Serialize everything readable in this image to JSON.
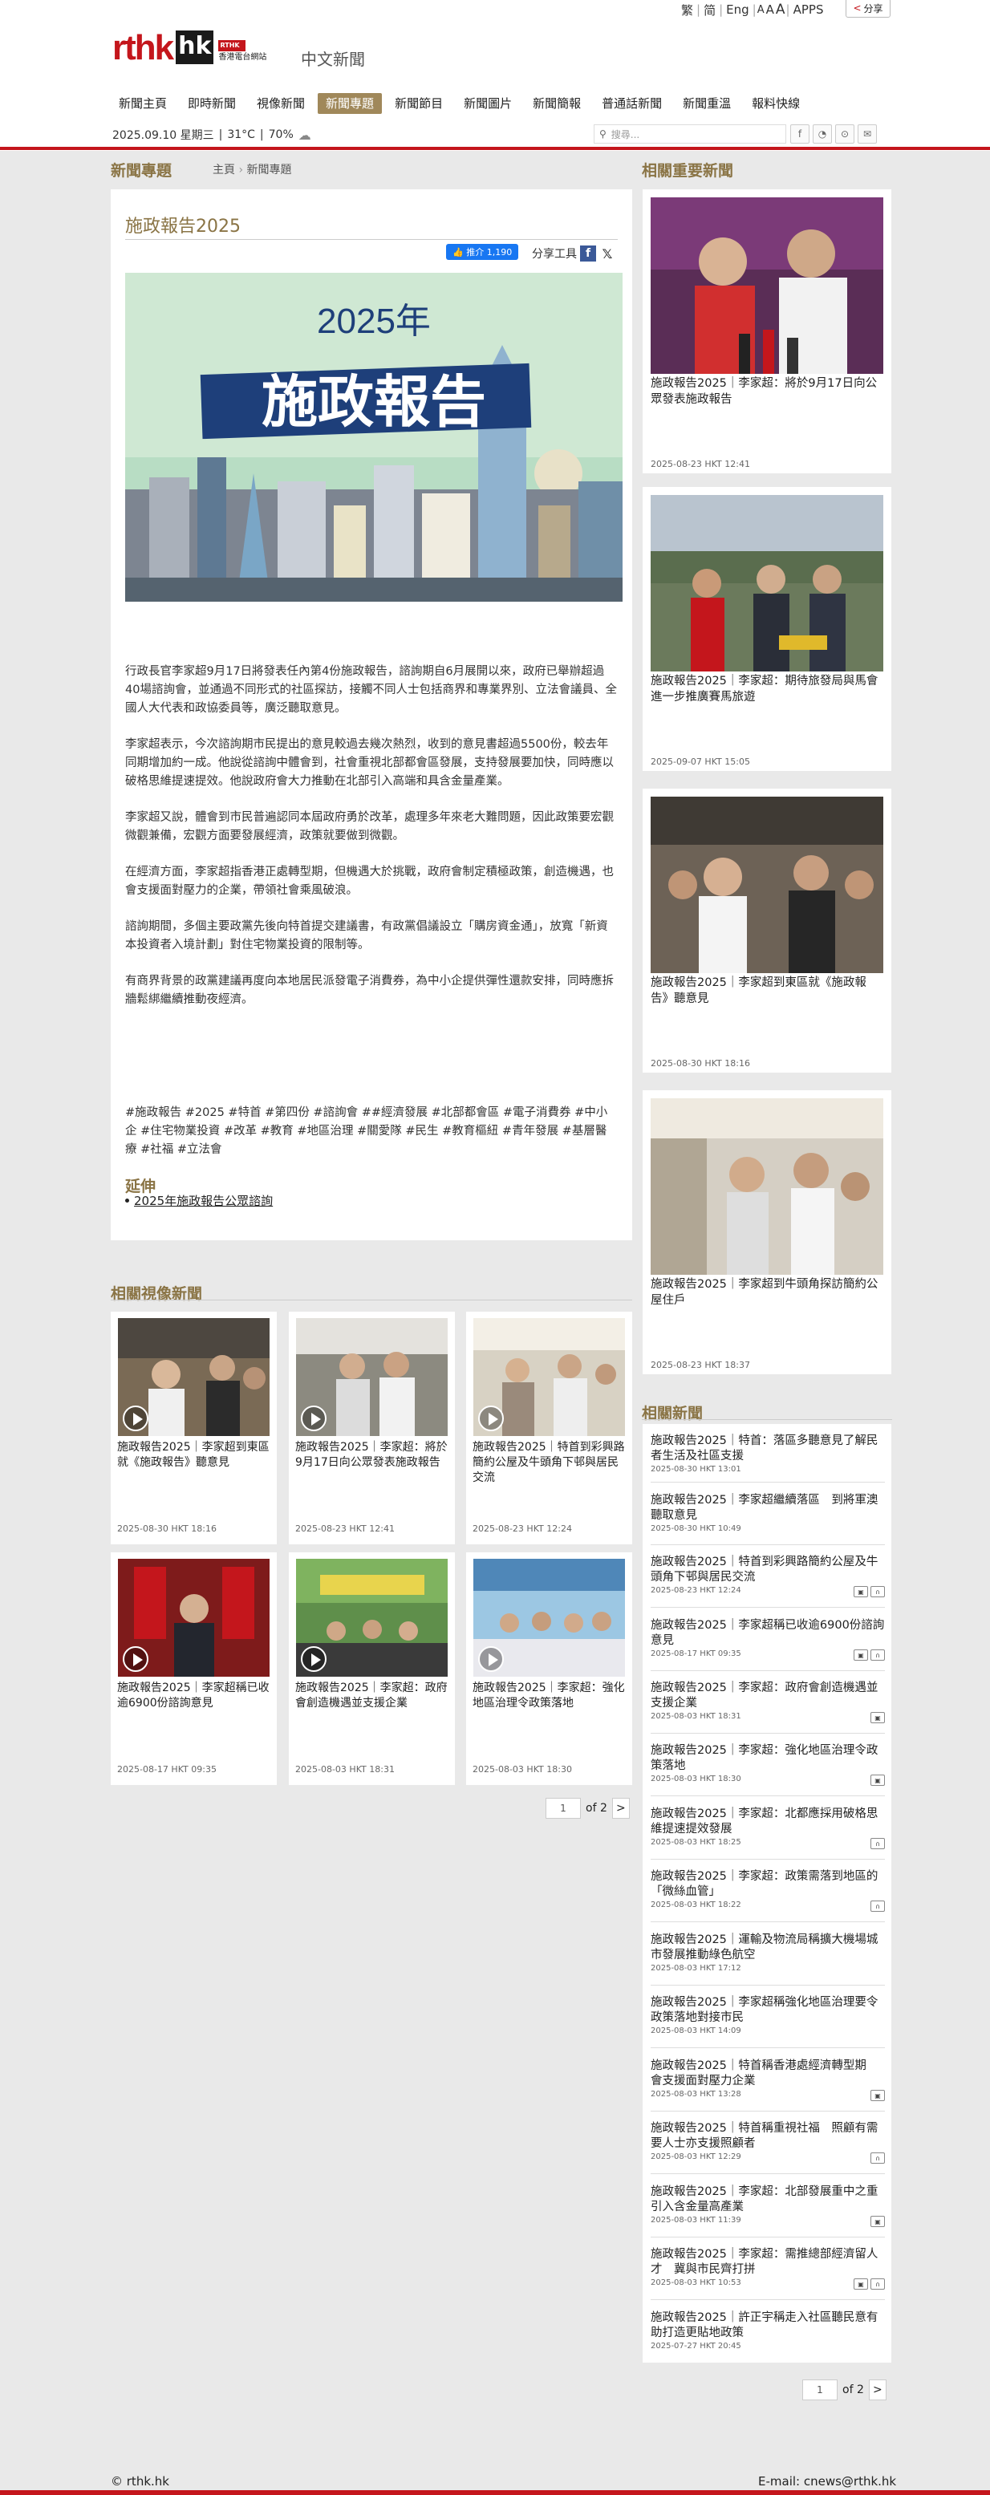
{
  "header": {
    "lang_links": [
      "繁",
      "简",
      "Eng",
      "A",
      "A",
      "A",
      "APPS"
    ],
    "share_label": "分享",
    "logo_text": "rthk",
    "logo_hk": "hk",
    "logo_station": "香港電台網站",
    "site_name": "中文新聞",
    "nav": [
      "新聞主頁",
      "即時新聞",
      "視像新聞",
      "新聞專題",
      "新聞節目",
      "新聞圖片",
      "新聞簡報",
      "普通話新聞",
      "新聞重溫",
      "報料快線"
    ],
    "nav_active_index": 3,
    "date": "2025.09.10 星期三",
    "temperature": "31°C",
    "humidity": "70%",
    "search_placeholder": "搜尋..."
  },
  "page": {
    "section_title": "新聞專題",
    "breadcrumb": [
      "主頁",
      "新聞專題"
    ]
  },
  "article": {
    "title": "施政報告2025",
    "fb_like": "推介 1,190",
    "share_tools": "分享工具",
    "hero_title_year": "2025年",
    "hero_title": "施政報告",
    "paragraphs": [
      "行政長官李家超9月17日將發表任內第4份施政報告，諮詢期自6月展開以來，政府已舉辦超過40場諮詢會，並通過不同形式的社區探訪，接觸不同人士包括商界和專業界別、立法會議員、全國人大代表和政協委員等，廣泛聽取意見。",
      "李家超表示，今次諮詢期市民提出的意見較過去幾次熱烈，收到的意見書超過5500份，較去年同期增加約一成。他說從諮詢中體會到，社會重視北部都會區發展，支持發展要加快，同時應以破格思維提速提效。他說政府會大力推動在北部引入高端和具含金量產業。",
      "李家超又說，體會到市民普遍認同本屆政府勇於改革，處理多年來老大難問題，因此政策要宏觀微觀兼備，宏觀方面要發展經濟，政策就要做到微觀。",
      "在經濟方面，李家超指香港正處轉型期，但機遇大於挑戰，政府會制定積極政策，創造機遇，也會支援面對壓力的企業，帶領社會乘風破浪。",
      "諮詢期間，多個主要政黨先後向特首提交建議書，有政黨倡議設立「購房資金通」，放寬「新資本投資者入境計劃」對住宅物業投資的限制等。",
      "有商界背景的政黨建議再度向本地居民派發電子消費券，為中小企提供彈性還款安排，同時應拆牆鬆綁繼續推動夜經濟。"
    ],
    "tags": "#施政報告 #2025 #特首 #第四份 #諮詢會 ##經濟發展 #北部都會區 #電子消費券 #中小企 #住宅物業投資 #改革 #教育 #地區治理 #關愛隊 #民生 #教育樞紐 #青年發展 #基層醫療 #社福 #立法會",
    "extend_title": "延伸",
    "extend_links": [
      "2025年施政報告公眾諮詢"
    ]
  },
  "video_section": {
    "title": "相關視像新聞",
    "items": [
      {
        "title": "施政報告2025｜李家超到東區就《施政報告》聽意見",
        "time": "2025-08-30 HKT 18:16"
      },
      {
        "title": "施政報告2025｜李家超：將於9月17日向公眾發表施政報告",
        "time": "2025-08-23 HKT 12:41"
      },
      {
        "title": "施政報告2025｜特首到彩興路簡約公屋及牛頭角下邨與居民交流",
        "time": "2025-08-23 HKT 12:24"
      },
      {
        "title": "施政報告2025｜李家超稱已收逾6900份諮詢意見",
        "time": "2025-08-17 HKT 09:35"
      },
      {
        "title": "施政報告2025｜李家超：政府會創造機遇並支援企業",
        "time": "2025-08-03 HKT 18:31"
      },
      {
        "title": "施政報告2025｜李家超：強化地區治理令政策落地",
        "time": "2025-08-03 HKT 18:30"
      }
    ],
    "pager": {
      "page": "1",
      "total": "of 2",
      "next": ">"
    }
  },
  "related_important": {
    "title": "相關重要新聞",
    "items": [
      {
        "title": "施政報告2025｜李家超：將於9月17日向公眾發表施政報告",
        "time": "2025-08-23 HKT 12:41"
      },
      {
        "title": "施政報告2025｜李家超：期待旅發局與馬會進一步推廣賽馬旅遊",
        "time": "2025-09-07 HKT 15:05"
      },
      {
        "title": "施政報告2025｜李家超到東區就《施政報告》聽意見",
        "time": "2025-08-30 HKT 18:16"
      },
      {
        "title": "施政報告2025｜李家超到牛頭角探訪簡約公屋住戶",
        "time": "2025-08-23 HKT 18:37"
      }
    ]
  },
  "related_news": {
    "title": "相關新聞",
    "items": [
      {
        "title": "施政報告2025｜特首：落區多聽意見了解民者生活及社區支援",
        "time": "2025-08-30 HKT 13:01",
        "icons": []
      },
      {
        "title": "施政報告2025｜李家超繼續落區　到將軍澳聽取意見",
        "time": "2025-08-30 HKT 10:49",
        "icons": []
      },
      {
        "title": "施政報告2025｜特首到彩興路簡約公屋及牛頭角下邨與居民交流",
        "time": "2025-08-23 HKT 12:24",
        "icons": [
          "video",
          "audio"
        ]
      },
      {
        "title": "施政報告2025｜李家超稱已收逾6900份諮詢意見",
        "time": "2025-08-17 HKT 09:35",
        "icons": [
          "video",
          "audio"
        ]
      },
      {
        "title": "施政報告2025｜李家超：政府會創造機遇並支援企業",
        "time": "2025-08-03 HKT 18:31",
        "icons": [
          "video"
        ]
      },
      {
        "title": "施政報告2025｜李家超：強化地區治理令政策落地",
        "time": "2025-08-03 HKT 18:30",
        "icons": [
          "video"
        ]
      },
      {
        "title": "施政報告2025｜李家超：北都應採用破格思維提速提效發展",
        "time": "2025-08-03 HKT 18:25",
        "icons": [
          "audio"
        ]
      },
      {
        "title": "施政報告2025｜李家超：政策需落到地區的「微絲血管」",
        "time": "2025-08-03 HKT 18:22",
        "icons": [
          "audio"
        ]
      },
      {
        "title": "施政報告2025｜運輸及物流局稱擴大機場城市發展推動綠色航空",
        "time": "2025-08-03 HKT 17:12",
        "icons": []
      },
      {
        "title": "施政報告2025｜李家超稱強化地區治理要令政策落地對接市民",
        "time": "2025-08-03 HKT 14:09",
        "icons": []
      },
      {
        "title": "施政報告2025｜特首稱香港處經濟轉型期　會支援面對壓力企業",
        "time": "2025-08-03 HKT 13:28",
        "icons": [
          "video"
        ]
      },
      {
        "title": "施政報告2025｜特首稱重視社福　照顧有需要人士亦支援照顧者",
        "time": "2025-08-03 HKT 12:29",
        "icons": [
          "audio"
        ]
      },
      {
        "title": "施政報告2025｜李家超：北部發展重中之重　引入含金量高產業",
        "time": "2025-08-03 HKT 11:39",
        "icons": [
          "video"
        ]
      },
      {
        "title": "施政報告2025｜李家超：需推總部經濟留人才　冀與市民齊打拼",
        "time": "2025-08-03 HKT 10:53",
        "icons": [
          "video",
          "audio"
        ]
      },
      {
        "title": "施政報告2025｜許正宇稱走入社區聽民意有助打造更貼地政策",
        "time": "2025-07-27 HKT 20:45",
        "icons": []
      }
    ],
    "pager": {
      "page": "1",
      "total": "of 2",
      "next": ">"
    }
  },
  "footer": {
    "copyright": "© rthk.hk",
    "email": "E-mail: cnews@rthk.hk"
  },
  "colors": {
    "brand_red": "#c4161c",
    "section_gold": "#8a7445",
    "nav_active": "#a0885a"
  }
}
